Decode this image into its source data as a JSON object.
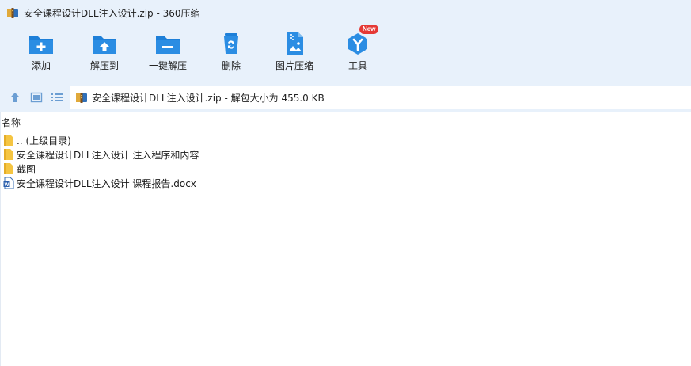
{
  "window": {
    "title": "安全课程设计DLL注入设计.zip - 360压缩"
  },
  "toolbar": {
    "items": [
      {
        "label": "添加",
        "icon": "add-file-icon"
      },
      {
        "label": "解压到",
        "icon": "extract-to-icon"
      },
      {
        "label": "一键解压",
        "icon": "one-click-extract-icon"
      },
      {
        "label": "删除",
        "icon": "delete-icon"
      },
      {
        "label": "图片压缩",
        "icon": "image-compress-icon"
      },
      {
        "label": "工具",
        "icon": "tools-icon",
        "badge": "New"
      }
    ]
  },
  "address": {
    "text": "安全课程设计DLL注入设计.zip - 解包大小为 455.0 KB"
  },
  "filelist": {
    "column_name": "名称",
    "rows": [
      {
        "name": ".. (上级目录)",
        "type": "folder"
      },
      {
        "name": "安全课程设计DLL注入设计 注入程序和内容",
        "type": "folder"
      },
      {
        "name": "截图",
        "type": "folder"
      },
      {
        "name": "安全课程设计DLL注入设计 课程报告.docx",
        "type": "docx"
      }
    ]
  },
  "colors": {
    "accent": "#1a7fd4",
    "toolbar_bg": "#e8f1fb",
    "folder": "#f5c542",
    "badge": "#e53935"
  }
}
